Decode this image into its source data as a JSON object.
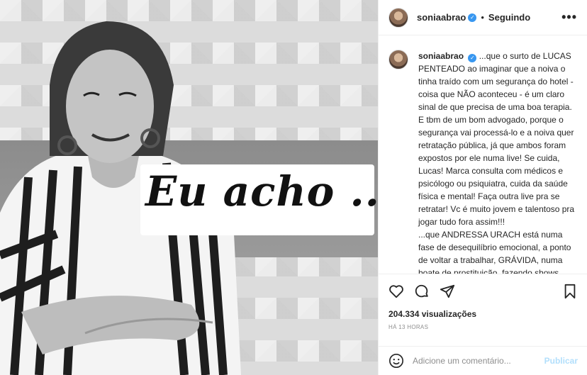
{
  "post": {
    "overlay_text": "Eu acho ..."
  },
  "header": {
    "username": "soniaabrao",
    "separator": "•",
    "following_label": "Seguindo",
    "more_label": "•••"
  },
  "caption": {
    "username": "soniaabrao",
    "text": "...que o surto de LUCAS PENTEADO ao imaginar que a noiva o tinha traído com um segurança do hotel - coisa que NÃO aconteceu - é um claro sinal de que precisa de uma boa terapia. E tbm de um bom advogado, porque o segurança vai processá-lo e a noiva quer retratação pública, já que ambos foram expostos por ele numa live! Se cuida, Lucas! Marca consulta com médicos e psicólogo ou psiquiatra, cuida da saúde física e mental! Faça outra live pra se retratar! Vc é muito jovem e talentoso pra jogar tudo fora assim!!!",
    "text2": "...que ANDRESSA URACH está numa fase de desequilíbrio emocional, a ponto de voltar a trabalhar, GRÁVIDA, numa boate de prostituição, fazendo shows eróticos como Ímola, seu nome de guerra nos tempos de garota de programa. Ngl..."
  },
  "stats": {
    "views": "204.334 visualizações",
    "time": "HÁ 13 HORAS"
  },
  "comment": {
    "placeholder": "Adicione um comentário...",
    "publish_label": "Publicar"
  },
  "icons": [
    "heart-icon",
    "comment-icon",
    "share-icon",
    "bookmark-icon",
    "emoji-icon",
    "verified-icon",
    "more-icon"
  ]
}
